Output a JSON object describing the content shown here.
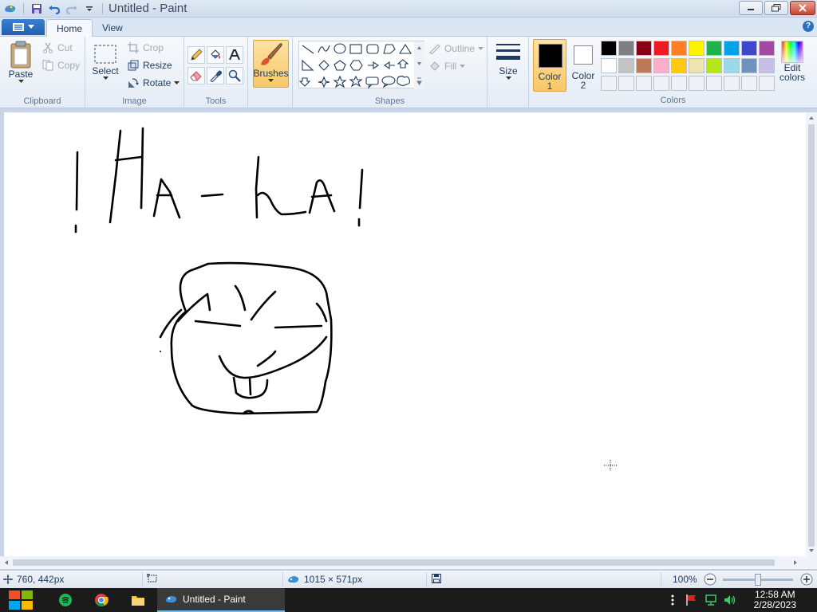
{
  "window": {
    "title": "Untitled - Paint"
  },
  "tabs": [
    {
      "label": "Home"
    },
    {
      "label": "View"
    }
  ],
  "clipboard": {
    "paste": "Paste",
    "cut": "Cut",
    "copy": "Copy",
    "group": "Clipboard"
  },
  "image": {
    "select": "Select",
    "crop": "Crop",
    "resize": "Resize",
    "rotate": "Rotate",
    "group": "Image"
  },
  "tools": {
    "group": "Tools"
  },
  "brushes": {
    "label": "Brushes"
  },
  "shapes": {
    "outline": "Outline",
    "fill": "Fill",
    "group": "Shapes"
  },
  "size": {
    "label": "Size"
  },
  "colors": {
    "color1_label": "Color",
    "color1_num": "1",
    "color2_label": "Color",
    "color2_num": "2",
    "edit_label": "Edit",
    "edit_label2": "colors",
    "group": "Colors",
    "color1_value": "#000000",
    "color2_value": "#ffffff",
    "palette_row1": [
      "#000000",
      "#7f7f7f",
      "#880015",
      "#ed1c24",
      "#ff7f27",
      "#fff200",
      "#22b14c",
      "#00a2e8",
      "#3f48cc",
      "#a349a4"
    ],
    "palette_row2": [
      "#ffffff",
      "#c3c3c3",
      "#b97a57",
      "#ffaec9",
      "#ffc90e",
      "#efe4b0",
      "#b5e61d",
      "#99d9ea",
      "#7092be",
      "#c8bfe7"
    ]
  },
  "status": {
    "position": "760, 442px",
    "dimensions": "1015 × 571px",
    "zoom": "100%"
  },
  "taskbar": {
    "app_label": "Untitled - Paint",
    "time": "12:58 AM",
    "date": "2/28/2023"
  }
}
